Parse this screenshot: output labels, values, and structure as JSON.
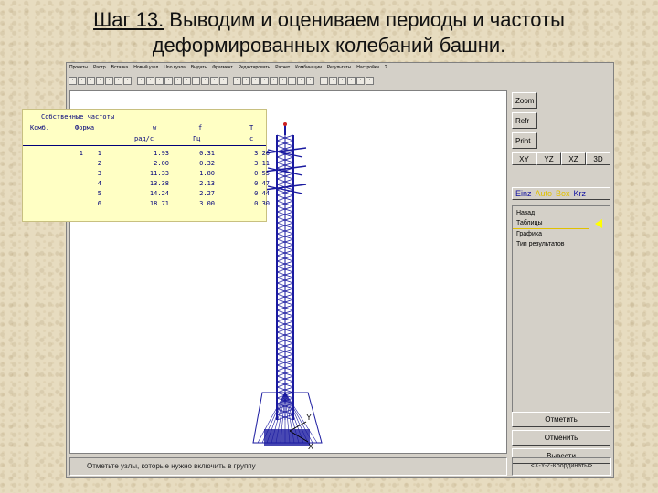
{
  "slide": {
    "title_step": "Шаг 13.",
    "title_line1": " Выводим и оцениваем периоды и частоты",
    "title_line2": "деформированных колебаний башни."
  },
  "app": {
    "menu": [
      "Проекты",
      "Растр",
      "Вставка",
      "Новый узел",
      "Uno вузла",
      "Выдать",
      "Фрагмент",
      "Редактировать",
      "Расчет",
      "Комбинации",
      "Результаты",
      "Настройки",
      "?"
    ],
    "toolbar_icons": [
      "new-icon",
      "open-icon",
      "save-icon",
      "print-icon",
      "cut-icon",
      "copy-icon",
      "paste-icon",
      "grid-icon",
      "node-icon",
      "bar-icon",
      "plate-icon",
      "load-icon",
      "support-icon",
      "hinge-icon",
      "section-icon",
      "material-icon",
      "calc-icon",
      "zoom-in-icon",
      "zoom-out-icon",
      "pan-icon",
      "rotate-icon",
      "select-icon",
      "filter-icon",
      "layer-icon",
      "view-icon",
      "info-icon",
      "lock-icon",
      "light-icon",
      "wire-icon",
      "mesh-icon",
      "color-icon",
      "exit-icon"
    ],
    "right_panel": {
      "zoom": "Zoom",
      "refr": "Refr",
      "print": "Print",
      "views": [
        "XY",
        "YZ",
        "XZ",
        "3D"
      ],
      "modes": [
        "Einz",
        "Auto",
        "Box",
        "Krz"
      ],
      "menu_items": [
        "Назад",
        "Таблицы",
        "Графика",
        "Тип результатов"
      ],
      "actions": [
        "Отметить",
        "Отменить",
        "Вывести"
      ]
    },
    "status_text": "Отметьте узлы, которые нужно включить в группу",
    "coord_text": "<X-Y-Z-Координаты>",
    "axis_labels": {
      "y": "Y",
      "x": "X"
    }
  },
  "freq_table": {
    "title": "Собственные частоты",
    "headers": [
      "Комб.",
      "Форма",
      "w",
      "f",
      "T"
    ],
    "units": [
      "",
      "",
      "рад/с",
      "Гц",
      "с"
    ],
    "rows": [
      [
        "1",
        "1",
        "1.93",
        "0.31",
        "3.26"
      ],
      [
        "",
        "2",
        "2.00",
        "0.32",
        "3.11"
      ],
      [
        "",
        "3",
        "11.33",
        "1.80",
        "0.55"
      ],
      [
        "",
        "4",
        "13.38",
        "2.13",
        "0.47"
      ],
      [
        "",
        "5",
        "14.24",
        "2.27",
        "0.44"
      ],
      [
        "",
        "6",
        "18.71",
        "3.00",
        "0.30"
      ]
    ]
  },
  "colors": {
    "tower": "#1a1aa0",
    "highlight": "#ffff00",
    "accent": "#e0c000"
  }
}
